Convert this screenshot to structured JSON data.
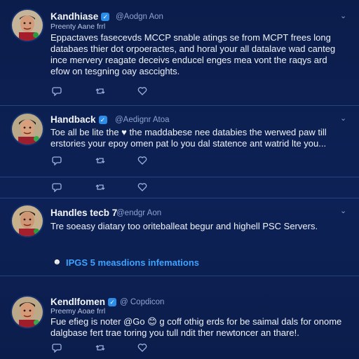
{
  "tweets": [
    {
      "name": "Kandhiase",
      "handle": "@Aodgn Aon",
      "subtitle": "Preenty Aane frrl",
      "body": [
        "Eppactaves fasecevds MCCP snable atings se from MCPT frees long",
        "databaes thier dot orpoeractes, and horal your all datalave wad canteg",
        "ince mervery reagate deceivs enducel enges mea vont the raqys ard",
        "efow on tesgning oay asccights."
      ]
    },
    {
      "name": "Handback",
      "handle": "@Aedignr Atoa",
      "subtitle": "",
      "body": [
        "Toe all be lite the ♥ the maddabese nee databies the werwed paw till",
        "erstories your epoy omen pat lo you dal statence ant watrid lte you..."
      ]
    },
    {
      "name": "Handles tecb 7",
      "handle": "@endgr Aon",
      "subtitle": "",
      "body": [
        "Tre soeasy diatary too oriteballeat begur and highell PSC Servers."
      ]
    },
    {
      "name": "Kendlfomen",
      "handle": "@ Copdicon",
      "subtitle": "Preemy Aoae frrl",
      "body": [
        "Fue efieg is noter @Go 😊 g coff othig erds for be saimal dals for onome",
        "dalgbase fert trae toring you tull ndit ther newtoncer an thare!."
      ]
    }
  ],
  "banner": {
    "icon": "☻",
    "text": "IPGS 5 measdions infemations"
  },
  "colors": {
    "background": "#0c1f4f",
    "accent": "#3ea2ff",
    "verified": "#2b8de8"
  },
  "icons": [
    "reply-icon",
    "retweet-icon",
    "like-icon",
    "chevron-down-icon",
    "verified-icon"
  ]
}
